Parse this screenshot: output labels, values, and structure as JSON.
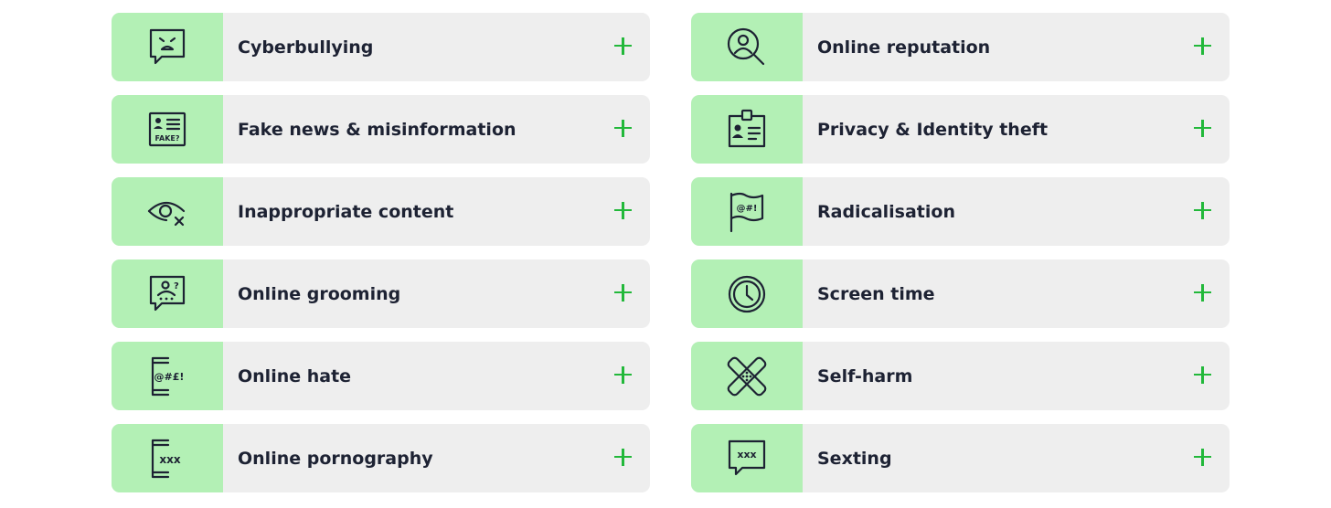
{
  "accent_color": "#22b83a",
  "icon_bg_color": "#b3f0b5",
  "item_bg_color": "#eeeeee",
  "left_column": [
    {
      "label": "Cyberbullying",
      "icon": "angry-chat-icon"
    },
    {
      "label": "Fake news & misinformation",
      "icon": "fake-id-card-icon"
    },
    {
      "label": "Inappropriate content",
      "icon": "eye-cross-icon"
    },
    {
      "label": "Online grooming",
      "icon": "grooming-chat-icon"
    },
    {
      "label": "Online hate",
      "icon": "hate-phone-icon"
    },
    {
      "label": "Online pornography",
      "icon": "xxx-phone-icon"
    }
  ],
  "right_column": [
    {
      "label": "Online reputation",
      "icon": "person-magnifier-icon"
    },
    {
      "label": "Privacy & Identity theft",
      "icon": "id-badge-icon"
    },
    {
      "label": "Radicalisation",
      "icon": "flag-icon"
    },
    {
      "label": "Screen time",
      "icon": "clock-icon"
    },
    {
      "label": "Self-harm",
      "icon": "bandages-icon"
    },
    {
      "label": "Sexting",
      "icon": "xxx-chat-icon"
    }
  ],
  "icon_text": {
    "fake": "FAKE?",
    "hate": "@#£!",
    "flag": "@#!",
    "xxx": "xxx",
    "question": "?"
  },
  "expand_icon": "plus-icon"
}
